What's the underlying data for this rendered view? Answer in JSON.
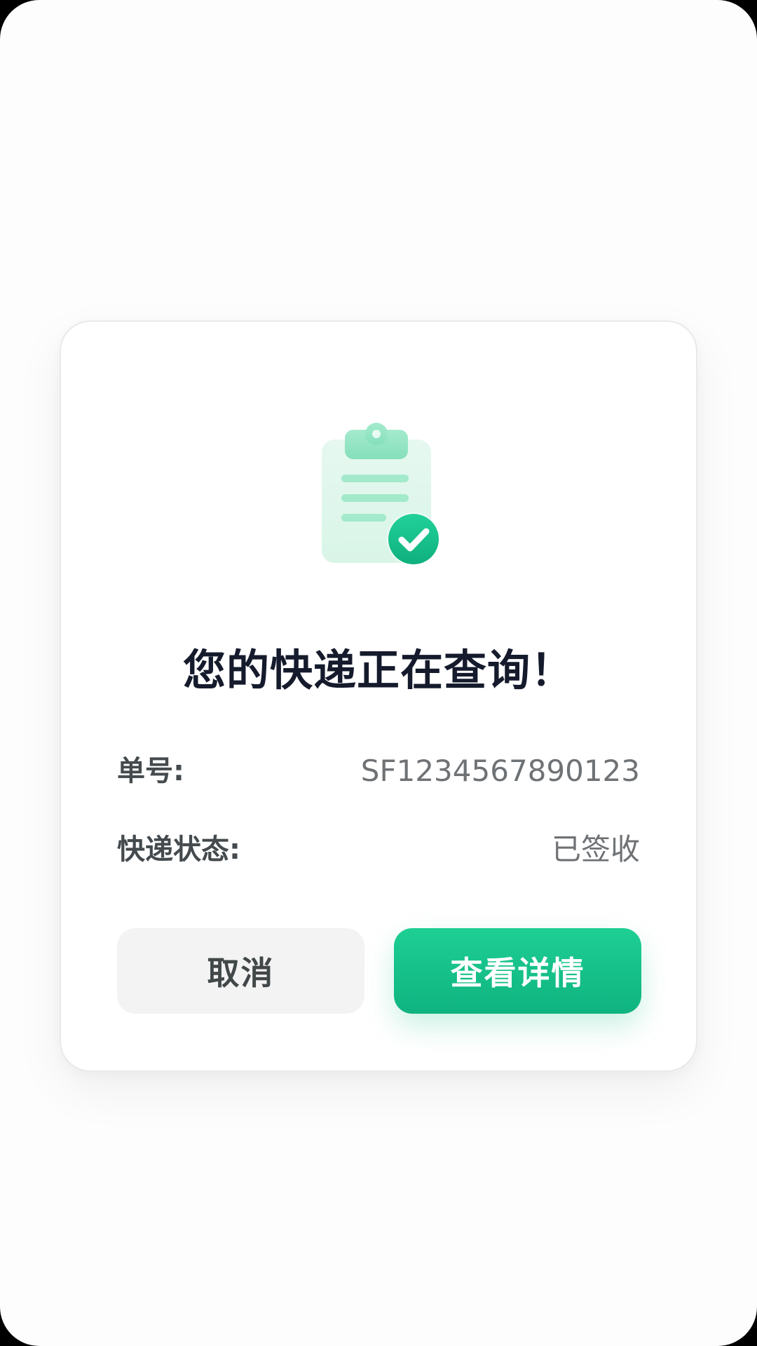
{
  "dialog": {
    "icon": "clipboard-check-icon",
    "title": "您的快递正在查询！",
    "fields": [
      {
        "label": "单号:",
        "value": "SF1234567890123"
      },
      {
        "label": "快递状态:",
        "value": "已签收"
      }
    ],
    "cancel_label": "取消",
    "confirm_label": "查看详情"
  },
  "colors": {
    "accent": "#16c089",
    "title": "#151b2c",
    "label": "#444a4d",
    "value": "#6f7275",
    "cancel_bg": "#f3f3f3"
  }
}
